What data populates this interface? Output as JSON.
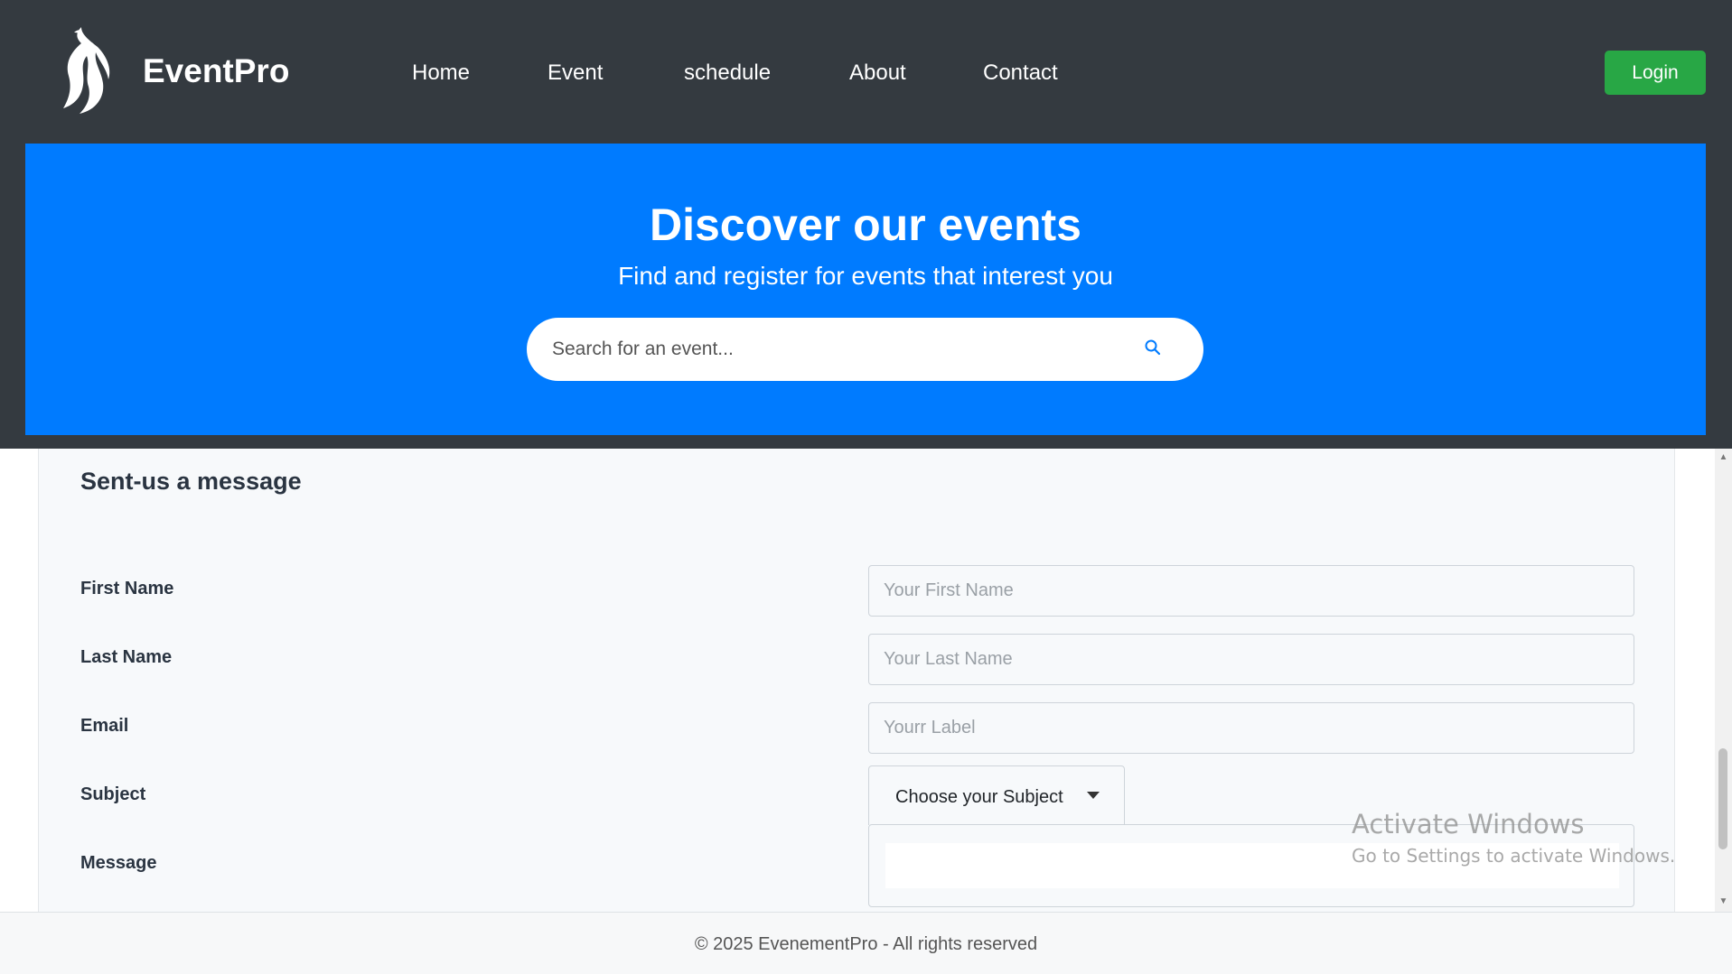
{
  "navbar": {
    "brand": "EventPro",
    "links": [
      "Home",
      "Event",
      "schedule",
      "About",
      "Contact"
    ],
    "login_label": "Login"
  },
  "hero": {
    "title": "Discover our events",
    "subtitle": "Find and register for events that interest you",
    "search_placeholder": "Search for an event..."
  },
  "form": {
    "heading": "Sent-us a message",
    "labels": {
      "first_name": "First Name",
      "last_name": "Last Name",
      "email": "Email",
      "subject": "Subject",
      "message": "Message"
    },
    "placeholders": {
      "first_name": "Your First Name",
      "last_name": "Your Last Name",
      "email": "Yourr Label"
    },
    "subject_selected": "Choose your Subject"
  },
  "watermark": {
    "title": "Activate Windows",
    "subtitle": "Go to Settings to activate Windows."
  },
  "footer": {
    "text": "© 2025 EvenementPro - All rights reserved"
  },
  "colors": {
    "navbar_bg": "#343a40",
    "hero_bg": "#007bff",
    "login_bg": "#28a745"
  },
  "icons": {
    "logo": "flame-logo-icon",
    "search": "search-icon",
    "subject_dropdown": "caret-down-icon",
    "scroll_up": "scroll-up-icon",
    "scroll_down": "scroll-down-icon"
  }
}
